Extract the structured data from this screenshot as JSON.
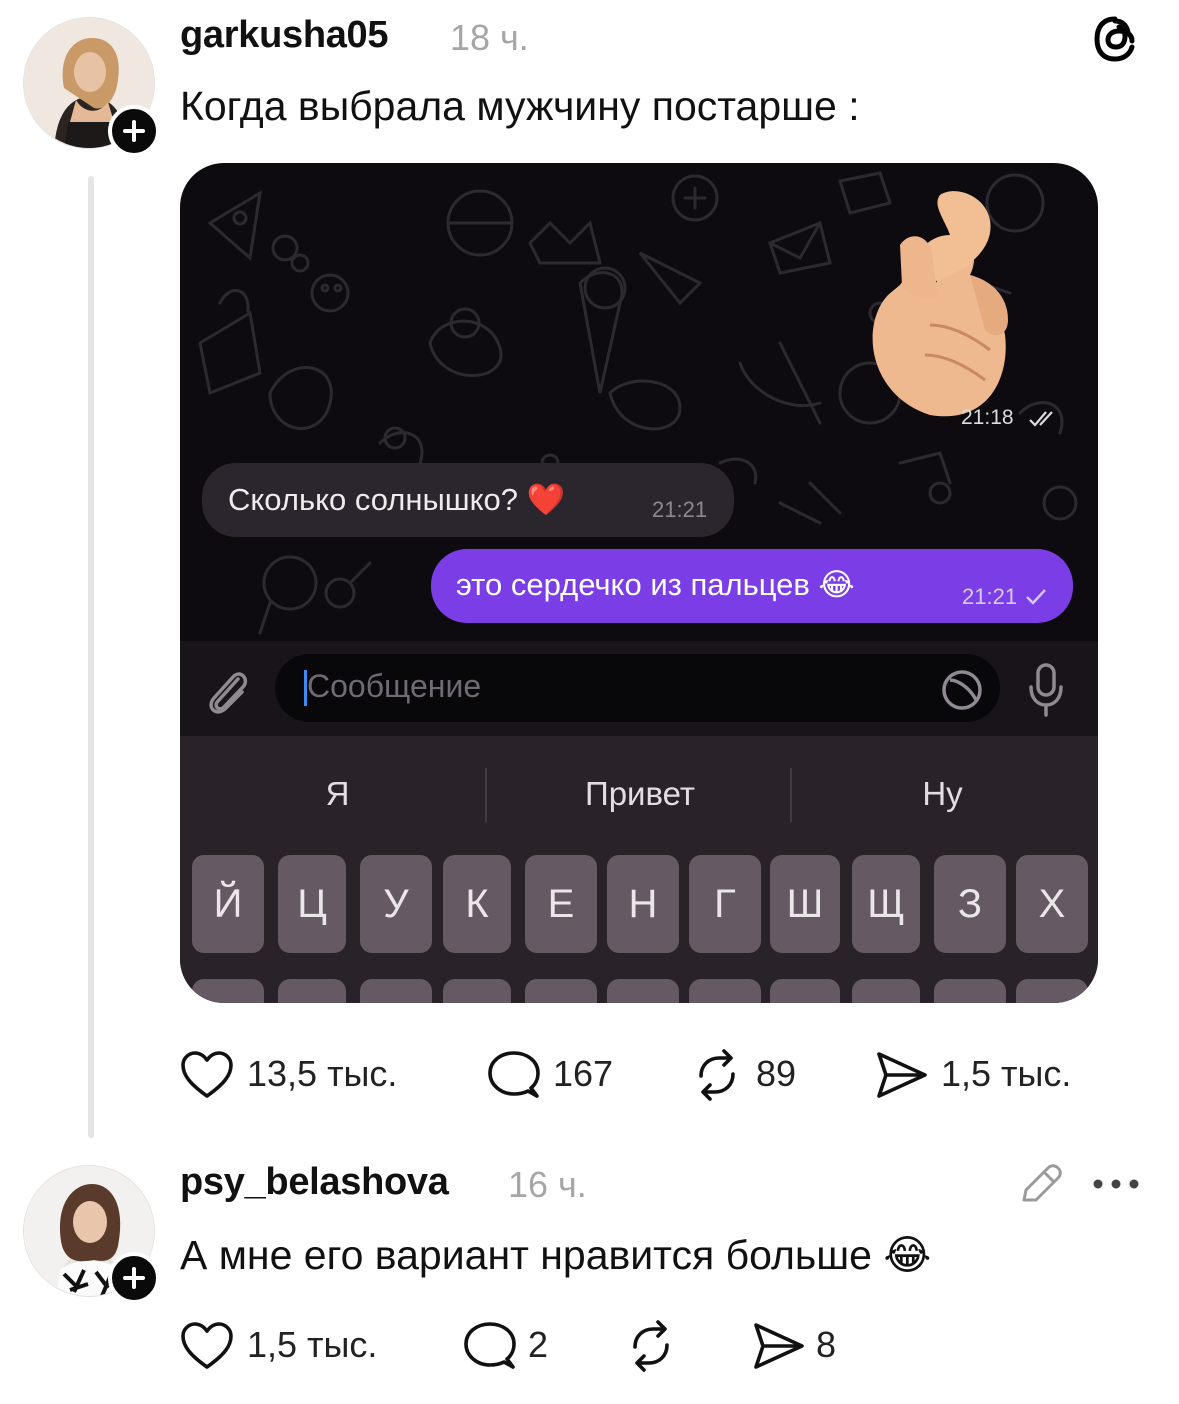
{
  "app": {
    "logo": "threads-logo-icon"
  },
  "post": {
    "username": "garkusha05",
    "time": "18 ч.",
    "text": "Когда выбрала мужчину постарше :",
    "image": {
      "sticker_time": "21:18",
      "incoming_text": "Сколько солнышко? ❤️",
      "incoming_time": "21:21",
      "outgoing_text": "это сердечко из пальцев 😂",
      "outgoing_time": "21:21",
      "input_placeholder": "Сообщение",
      "suggestions": [
        "Я",
        "Привет",
        "Ну"
      ],
      "keys": [
        "Й",
        "Ц",
        "У",
        "К",
        "Е",
        "Н",
        "Г",
        "Ш",
        "Щ",
        "З",
        "Х"
      ]
    },
    "likes": "13,5 тыс.",
    "replies": "167",
    "reposts": "89",
    "shares": "1,5 тыс."
  },
  "reply": {
    "username": "psy_belashova",
    "time": "16 ч.",
    "text": "А мне его вариант нравится больше 😂",
    "likes": "1,5 тыс.",
    "replies": "2",
    "shares": "8"
  }
}
